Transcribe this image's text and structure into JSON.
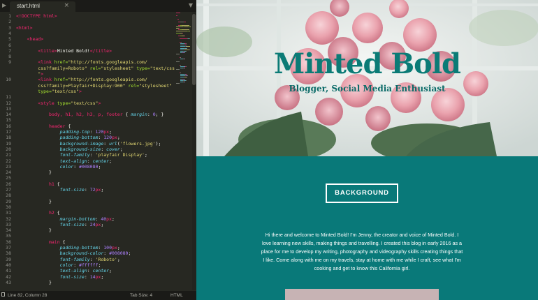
{
  "editor": {
    "tab": {
      "filename": "start.html",
      "close_icon": "×"
    },
    "status": {
      "position": "Line 82, Column 28",
      "tab_size": "Tab Size: 4",
      "syntax": "HTML"
    }
  },
  "preview": {
    "hero": {
      "title": "Minted Bold",
      "subtitle": "Blogger, Social Media Enthusiast"
    },
    "button_label": "BACKGROUND",
    "about_text": "Hi there and welcome to Minted Bold! I'm Jenny, the creator and voice of Minted Bold. I love learning new skills, making things and travelling. I created this blog in early 2016 as a place for me to develop my writing, photography and videography skills creating things that I like. Come along with me on my travels, stay at home with me while I craft, see what I'm cooking and get to know this California girl."
  },
  "colors": {
    "teal": "#0a7a7a",
    "editor_bg": "#272822"
  },
  "code_lines": [
    {
      "n": "1",
      "t": [
        [
          "tg",
          "<!DOCTYPE html>"
        ]
      ]
    },
    {
      "n": "2",
      "t": []
    },
    {
      "n": "3",
      "t": [
        [
          "tg",
          "<html>"
        ]
      ]
    },
    {
      "n": "4",
      "t": []
    },
    {
      "n": "5",
      "t": [
        [
          "pu",
          "    "
        ],
        [
          "tg",
          "<head>"
        ]
      ]
    },
    {
      "n": "6",
      "t": []
    },
    {
      "n": "7",
      "t": [
        [
          "pu",
          "        "
        ],
        [
          "tg",
          "<title>"
        ],
        [
          "pu",
          "Minted Bold!"
        ],
        [
          "tg",
          "</title>"
        ]
      ]
    },
    {
      "n": "8",
      "t": []
    },
    {
      "n": "9",
      "t": [
        [
          "pu",
          "        "
        ],
        [
          "tg",
          "<link "
        ],
        [
          "at",
          "href="
        ],
        [
          "st",
          "\"http://fonts.googleapis.com/"
        ]
      ]
    },
    {
      "n": "",
      "t": [
        [
          "st",
          "        css?family=Roboto\""
        ],
        [
          "at",
          " rel="
        ],
        [
          "st",
          "\"stylesheet\""
        ],
        [
          "at",
          " type="
        ],
        [
          "st",
          "\"text/css"
        ]
      ]
    },
    {
      "n": "",
      "t": [
        [
          "st",
          "        \""
        ],
        [
          "tg",
          ">"
        ]
      ]
    },
    {
      "n": "10",
      "t": [
        [
          "pu",
          "        "
        ],
        [
          "tg",
          "<link "
        ],
        [
          "at",
          "href="
        ],
        [
          "st",
          "\"http://fonts.googleapis.com/"
        ]
      ]
    },
    {
      "n": "",
      "t": [
        [
          "st",
          "        css?family=Playfair+Display:900\""
        ],
        [
          "at",
          " rel="
        ],
        [
          "st",
          "\"stylesheet\""
        ]
      ]
    },
    {
      "n": "",
      "t": [
        [
          "at",
          "        type="
        ],
        [
          "st",
          "\"text/css\""
        ],
        [
          "tg",
          ">"
        ]
      ]
    },
    {
      "n": "11",
      "t": []
    },
    {
      "n": "12",
      "t": [
        [
          "pu",
          "        "
        ],
        [
          "tg",
          "<style "
        ],
        [
          "at",
          "type="
        ],
        [
          "st",
          "\"text/css\""
        ],
        [
          "tg",
          ">"
        ]
      ]
    },
    {
      "n": "13",
      "t": []
    },
    {
      "n": "14",
      "t": [
        [
          "pu",
          "            "
        ],
        [
          "sl",
          "body, h1, h2, h3, p, footer"
        ],
        [
          "pu",
          " { "
        ],
        [
          "pr",
          "margin"
        ],
        [
          "pu",
          ": "
        ],
        [
          "nm",
          "0"
        ],
        [
          "pu",
          "; }"
        ]
      ]
    },
    {
      "n": "15",
      "t": []
    },
    {
      "n": "16",
      "t": [
        [
          "pu",
          "            "
        ],
        [
          "sl",
          "header"
        ],
        [
          "pu",
          " {"
        ]
      ]
    },
    {
      "n": "17",
      "t": [
        [
          "pu",
          "                "
        ],
        [
          "pr",
          "padding-top"
        ],
        [
          "pu",
          ": "
        ],
        [
          "nm",
          "120"
        ],
        [
          "sl",
          "px"
        ],
        [
          "pu",
          ";"
        ]
      ]
    },
    {
      "n": "18",
      "t": [
        [
          "pu",
          "                "
        ],
        [
          "pr",
          "padding-bottom"
        ],
        [
          "pu",
          ": "
        ],
        [
          "nm",
          "120"
        ],
        [
          "sl",
          "px"
        ],
        [
          "pu",
          ";"
        ]
      ]
    },
    {
      "n": "19",
      "t": [
        [
          "pu",
          "                "
        ],
        [
          "pr",
          "background-image"
        ],
        [
          "pu",
          ": "
        ],
        [
          "pr",
          "url"
        ],
        [
          "pu",
          "("
        ],
        [
          "st",
          "'flowers.jpg'"
        ],
        [
          "pu",
          ");"
        ]
      ]
    },
    {
      "n": "20",
      "t": [
        [
          "pu",
          "                "
        ],
        [
          "pr",
          "background-size"
        ],
        [
          "pu",
          ": "
        ],
        [
          "pr",
          "cover"
        ],
        [
          "pu",
          ";"
        ]
      ]
    },
    {
      "n": "21",
      "t": [
        [
          "pu",
          "                "
        ],
        [
          "pr",
          "font-family"
        ],
        [
          "pu",
          ": "
        ],
        [
          "st",
          "'playfair Display'"
        ],
        [
          "pu",
          ";"
        ]
      ]
    },
    {
      "n": "22",
      "t": [
        [
          "pu",
          "                "
        ],
        [
          "pr",
          "text-align"
        ],
        [
          "pu",
          ": "
        ],
        [
          "pr",
          "center"
        ],
        [
          "pu",
          ";"
        ]
      ]
    },
    {
      "n": "23",
      "t": [
        [
          "pu",
          "                "
        ],
        [
          "pr",
          "color"
        ],
        [
          "pu",
          ": "
        ],
        [
          "nm",
          "#008080"
        ],
        [
          "pu",
          ";"
        ]
      ]
    },
    {
      "n": "24",
      "t": [
        [
          "pu",
          "            }"
        ]
      ]
    },
    {
      "n": "25",
      "t": []
    },
    {
      "n": "26",
      "t": [
        [
          "pu",
          "            "
        ],
        [
          "sl",
          "h1"
        ],
        [
          "pu",
          " {"
        ]
      ]
    },
    {
      "n": "27",
      "t": [
        [
          "pu",
          "                "
        ],
        [
          "pr",
          "font-size"
        ],
        [
          "pu",
          ": "
        ],
        [
          "nm",
          "72"
        ],
        [
          "sl",
          "px"
        ],
        [
          "pu",
          ";"
        ]
      ]
    },
    {
      "n": "28",
      "t": []
    },
    {
      "n": "29",
      "t": [
        [
          "pu",
          "            }"
        ]
      ]
    },
    {
      "n": "30",
      "t": []
    },
    {
      "n": "31",
      "t": [
        [
          "pu",
          "            "
        ],
        [
          "sl",
          "h2"
        ],
        [
          "pu",
          " {"
        ]
      ]
    },
    {
      "n": "32",
      "t": [
        [
          "pu",
          "                "
        ],
        [
          "pr",
          "margin-bottom"
        ],
        [
          "pu",
          ": "
        ],
        [
          "nm",
          "40"
        ],
        [
          "sl",
          "px"
        ],
        [
          "pu",
          ";"
        ]
      ]
    },
    {
      "n": "33",
      "t": [
        [
          "pu",
          "                "
        ],
        [
          "pr",
          "font-size"
        ],
        [
          "pu",
          ": "
        ],
        [
          "nm",
          "24"
        ],
        [
          "sl",
          "px"
        ],
        [
          "pu",
          ";"
        ]
      ]
    },
    {
      "n": "34",
      "t": [
        [
          "pu",
          "            }"
        ]
      ]
    },
    {
      "n": "35",
      "t": []
    },
    {
      "n": "36",
      "t": [
        [
          "pu",
          "            "
        ],
        [
          "sl",
          "main"
        ],
        [
          "pu",
          " {"
        ]
      ]
    },
    {
      "n": "37",
      "t": [
        [
          "pu",
          "                "
        ],
        [
          "pr",
          "padding-bottom"
        ],
        [
          "pu",
          ": "
        ],
        [
          "nm",
          "100"
        ],
        [
          "sl",
          "px"
        ],
        [
          "pu",
          ";"
        ]
      ]
    },
    {
      "n": "38",
      "t": [
        [
          "pu",
          "                "
        ],
        [
          "pr",
          "background-color"
        ],
        [
          "pu",
          ": "
        ],
        [
          "nm",
          "#008080"
        ],
        [
          "pu",
          ";"
        ]
      ]
    },
    {
      "n": "39",
      "t": [
        [
          "pu",
          "                "
        ],
        [
          "pr",
          "font-family"
        ],
        [
          "pu",
          ": "
        ],
        [
          "st",
          "'Roboto'"
        ],
        [
          "pu",
          ";"
        ]
      ]
    },
    {
      "n": "40",
      "t": [
        [
          "pu",
          "                "
        ],
        [
          "pr",
          "color"
        ],
        [
          "pu",
          ": "
        ],
        [
          "nm",
          "#ffffff"
        ],
        [
          "pu",
          ";"
        ]
      ]
    },
    {
      "n": "41",
      "t": [
        [
          "pu",
          "                "
        ],
        [
          "pr",
          "text-align"
        ],
        [
          "pu",
          ": "
        ],
        [
          "pr",
          "center"
        ],
        [
          "pu",
          ";"
        ]
      ]
    },
    {
      "n": "42",
      "t": [
        [
          "pu",
          "                "
        ],
        [
          "pr",
          "font-size"
        ],
        [
          "pu",
          ": "
        ],
        [
          "nm",
          "14"
        ],
        [
          "sl",
          "px"
        ],
        [
          "pu",
          ";"
        ]
      ]
    },
    {
      "n": "43",
      "t": [
        [
          "pu",
          "            }"
        ]
      ]
    }
  ]
}
